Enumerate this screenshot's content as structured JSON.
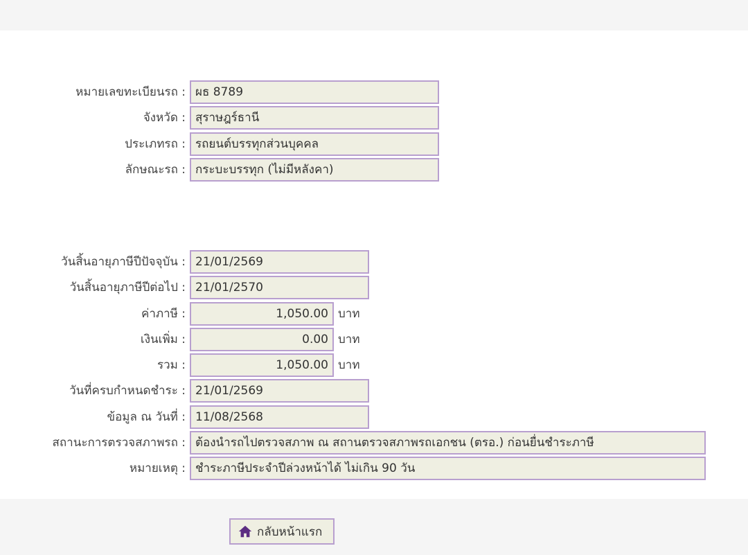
{
  "vehicle": {
    "plate_label": "หมายเลขทะเบียนรถ :",
    "plate_value": "ผธ 8789",
    "province_label": "จังหวัด :",
    "province_value": "สุราษฎร์ธานี",
    "type_label": "ประเภทรถ :",
    "type_value": "รถยนต์บรรทุกส่วนบุคคล",
    "body_label": "ลักษณะรถ :",
    "body_value": "กระบะบรรทุก (ไม่มีหลังคา)"
  },
  "tax": {
    "current_expiry_label": "วันสิ้นอายุภาษีปีปัจจุบัน :",
    "current_expiry_value": "21/01/2569",
    "next_expiry_label": "วันสิ้นอายุภาษีปีต่อไป :",
    "next_expiry_value": "21/01/2570",
    "tax_amount_label": "ค่าภาษี :",
    "tax_amount_value": "1,050.00",
    "surcharge_label": "เงินเพิ่ม :",
    "surcharge_value": "0.00",
    "total_label": "รวม :",
    "total_value": "1,050.00",
    "currency_unit": "บาท",
    "due_date_label": "วันที่ครบกำหนดชำระ :",
    "due_date_value": "21/01/2569",
    "data_as_of_label": "ข้อมูล ณ วันที่ :",
    "data_as_of_value": "11/08/2568",
    "inspection_status_label": "สถานะการตรวจสภาพรถ :",
    "inspection_status_value": "ต้องนำรถไปตรวจสภาพ ณ สถานตรวจสภาพรถเอกชน (ตรอ.) ก่อนยื่นชำระภาษี",
    "remark_label": "หมายเหตุ :",
    "remark_value": "ชำระภาษีประจำปีล่วงหน้าได้ ไม่เกิน 90 วัน"
  },
  "actions": {
    "home_label": "กลับหน้าแรก",
    "home_icon": "home-icon"
  },
  "colors": {
    "field_background": "#efefe2",
    "field_border": "#b89fcf",
    "icon_purple": "#5c2d82"
  }
}
